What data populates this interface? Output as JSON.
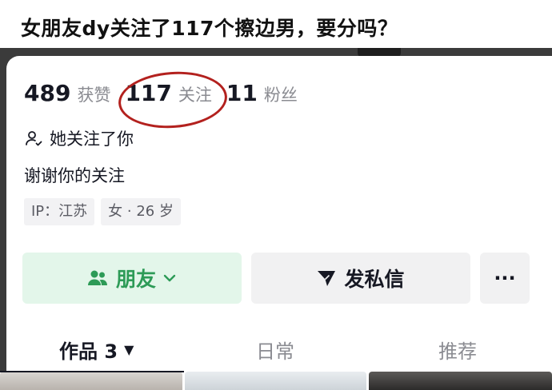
{
  "post": {
    "title": "女朋友dy关注了117个擦边男，要分吗？"
  },
  "profile": {
    "stats": [
      {
        "value": "489",
        "label": "获赞"
      },
      {
        "value": "117",
        "label": "关注"
      },
      {
        "value": "11",
        "label": "粉丝"
      }
    ],
    "follows_you_text": "她关注了你",
    "bio": "谢谢你的关注",
    "tags": [
      "IP：江苏",
      "女 · 26 岁"
    ]
  },
  "actions": {
    "friend_label": "朋友",
    "message_label": "发私信",
    "more_label": "···"
  },
  "tabs": [
    {
      "label": "作品 3",
      "active": true
    },
    {
      "label": "日常",
      "active": false
    },
    {
      "label": "推荐",
      "active": false
    }
  ],
  "colors": {
    "accent_green": "#2d9b57",
    "friend_button_bg": "#e3f6ea",
    "annotation_red": "#b3211e"
  },
  "icons": {
    "follows_you": "person-check-icon",
    "friend": "friends-icon",
    "message": "send-icon",
    "chevron": "chevron-down-icon",
    "tab_caret": "caret-down-icon"
  }
}
